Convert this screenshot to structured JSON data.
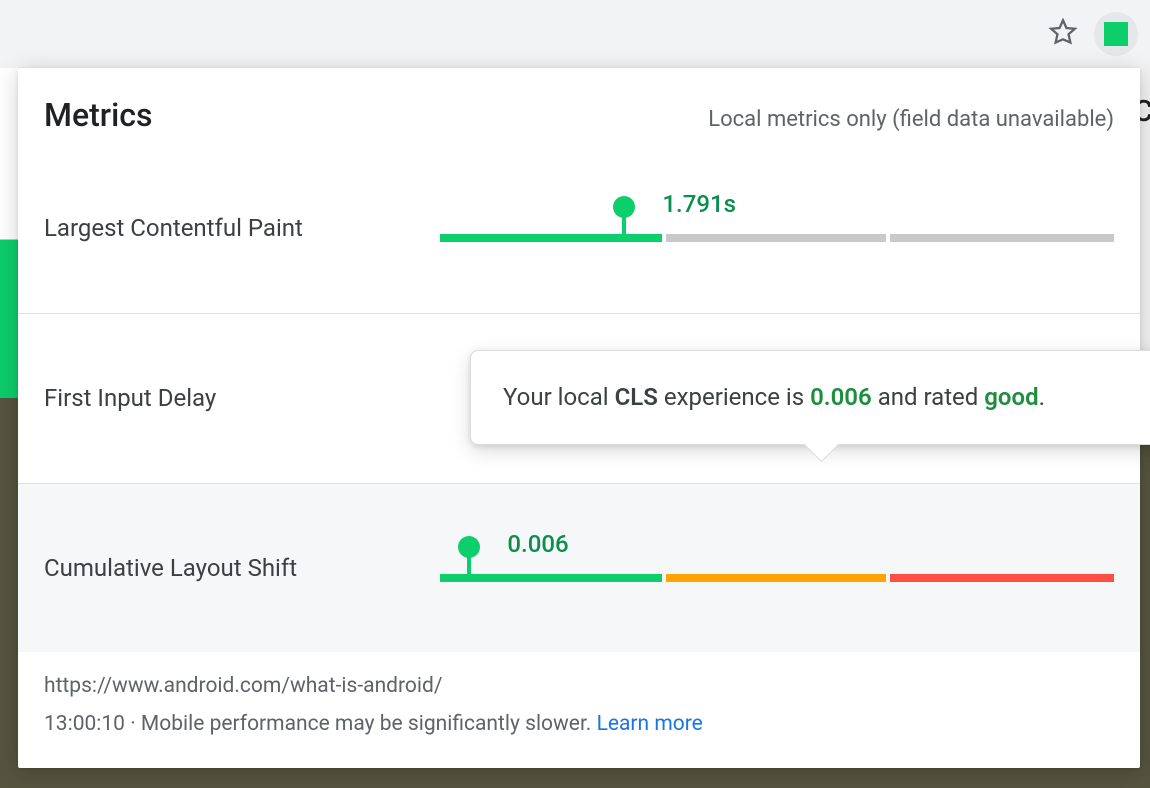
{
  "omnibox": {
    "extension_status_color": "#0cce6b"
  },
  "header": {
    "title": "Metrics",
    "subtitle": "Local metrics only (field data unavailable)"
  },
  "metrics": {
    "lcp": {
      "label": "Largest Contentful Paint",
      "value": "1.791s",
      "segments": [
        {
          "kind": "g",
          "pct": 33.4
        },
        {
          "kind": "n",
          "pct": 33.0
        },
        {
          "kind": "n",
          "pct": 33.6
        }
      ],
      "value_pos_pct": 33.0,
      "marker_pos_pct": 27.0
    },
    "fid": {
      "label": "First Input Delay"
    },
    "cls": {
      "label": "Cumulative Layout Shift",
      "value": "0.006",
      "segments": [
        {
          "kind": "g",
          "pct": 33.4
        },
        {
          "kind": "o",
          "pct": 33.0
        },
        {
          "kind": "r",
          "pct": 33.6
        }
      ],
      "value_pos_pct": 10.0,
      "marker_pos_pct": 4.0
    }
  },
  "tooltip": {
    "prefix": "Your local ",
    "metric": "CLS",
    "mid": " experience is ",
    "value": "0.006",
    "post": " and rated ",
    "rating": "good",
    "tail": "."
  },
  "footer": {
    "url": "https://www.android.com/what-is-android/",
    "time": "13:00:10",
    "separator": "  ·  ",
    "note": "Mobile performance may be significantly slower. ",
    "learn_more": "Learn more"
  },
  "truncated_edge": "C"
}
